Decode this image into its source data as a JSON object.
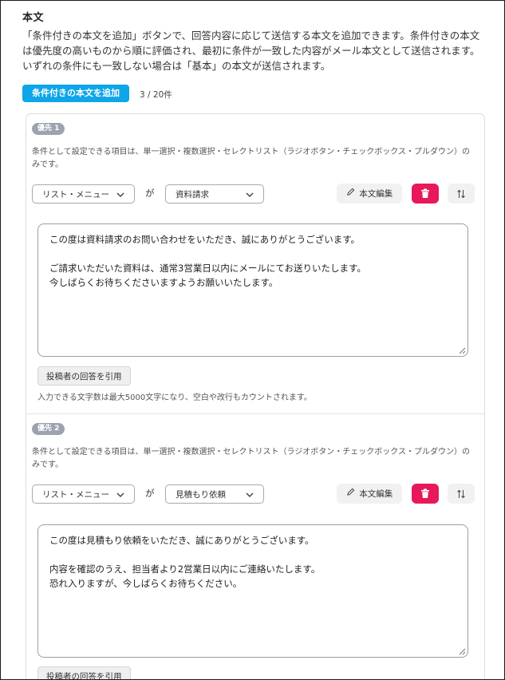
{
  "section": {
    "title": "本文",
    "description": "「条件付きの本文を追加」ボタンで、回答内容に応じて送信する本文を追加できます。条件付きの本文は優先度の高いものから順に評価され、最初に条件が一致した内容がメール本文として送信されます。いずれの条件にも一致しない場合は「基本」の本文が送信されます。",
    "add_button": "条件付きの本文を追加",
    "count": "3 / 20件"
  },
  "common": {
    "condition_note": "条件として設定できる項目は、単一選択・複数選択・セレクトリスト（ラジオボタン・チェックボックス・プルダウン）のみです。",
    "operator": "が",
    "edit_button": "本文編集",
    "edit_icon": "pencil-icon",
    "delete_icon": "trash-icon",
    "sort_icon": "sort-arrows-icon",
    "quote_button": "投稿者の回答を引用",
    "limit_note": "入力できる文字数は最大5000文字になり、空白や改行もカウントされます。",
    "accent_color": "#0ea5e9",
    "delete_color": "#e8195a"
  },
  "conditions": [
    {
      "priority": "優先 1",
      "field": "リスト・メニュー",
      "value": "資料請求",
      "body": "この度は資料請求のお問い合わせをいただき、誠にありがとうございます。\n\nご請求いただいた資料は、通常3営業日以内にメールにてお送りいたします。\n今しばらくお待ちくださいますようお願いいたします。"
    },
    {
      "priority": "優先 2",
      "field": "リスト・メニュー",
      "value": "見積もり依頼",
      "body": "この度は見積もり依頼をいただき、誠にありがとうございます。\n\n内容を確認のうえ、担当者より2営業日以内にご連絡いたします。\n恐れ入りますが、今しばらくお待ちください。"
    }
  ]
}
